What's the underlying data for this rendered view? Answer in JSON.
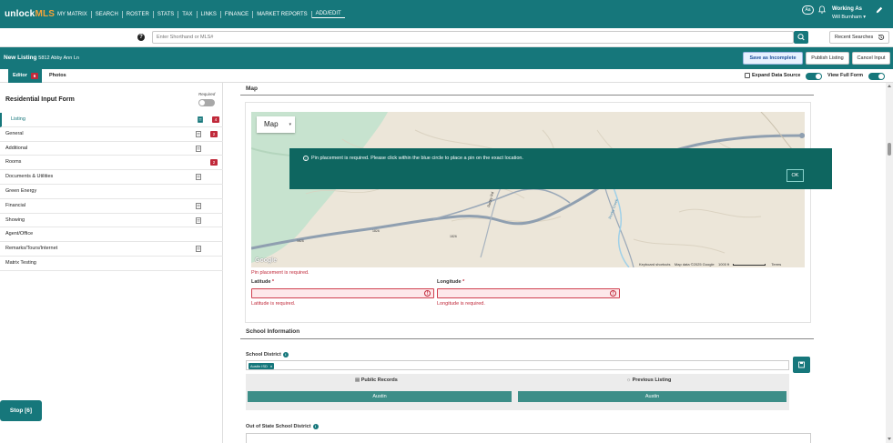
{
  "brand": {
    "unlock": "unlock",
    "mls": "MLS"
  },
  "nav": {
    "links": [
      "MY MATRIX",
      "SEARCH",
      "ROSTER",
      "STATS",
      "TAX",
      "LINKS",
      "FINANCE",
      "MARKET REPORTS",
      "ADD/EDIT"
    ],
    "active": "ADD/EDIT",
    "font_toggle": "Aa",
    "working_as_label": "Working As",
    "user_name": "Will Burnham ▾"
  },
  "search": {
    "placeholder": "Enter Shorthand or MLS#",
    "recent_label": "Recent Searches"
  },
  "listing": {
    "title": "New Listing",
    "address": "5812 Abby Ann Ln",
    "buttons": {
      "save_incomplete": "Save as Incomplete",
      "publish": "Publish Listing",
      "cancel": "Cancel Input"
    }
  },
  "tabs": {
    "editor": "Editor",
    "editor_count": "6",
    "photos": "Photos",
    "expand_data_source": "Expand Data Source",
    "view_full_form": "View Full Form"
  },
  "sidebar": {
    "title": "Residential Input Form",
    "required_label": "Required",
    "items": [
      {
        "label": "Listing",
        "icon": "doc-icon",
        "badge": "4"
      },
      {
        "label": "General",
        "icon": "doc-icon",
        "badge": "2"
      },
      {
        "label": "Additional",
        "icon": "doc-icon",
        "badge": ""
      },
      {
        "label": "Rooms",
        "icon": "",
        "badge": "2"
      },
      {
        "label": "Documents & Utilities",
        "icon": "doc-icon",
        "badge": ""
      },
      {
        "label": "Green Energy",
        "icon": "",
        "badge": ""
      },
      {
        "label": "Financial",
        "icon": "doc-icon",
        "badge": ""
      },
      {
        "label": "Showing",
        "icon": "doc-icon",
        "badge": ""
      },
      {
        "label": "Agent/Office",
        "icon": "",
        "badge": ""
      },
      {
        "label": "Remarks/Tours/Internet",
        "icon": "doc-icon",
        "badge": ""
      },
      {
        "label": "Matrix Testing",
        "icon": "",
        "badge": ""
      }
    ],
    "stop_label": "Stop [6]"
  },
  "map_section": {
    "title": "Map",
    "map_type": "Map",
    "google_logo": "Google",
    "road_labels": [
      "1826",
      "1826",
      "Rocky Rd",
      "1826",
      "Rocky Creek"
    ],
    "footer": {
      "shortcuts": "Keyboard shortcuts",
      "data": "Map data ©2025 Google",
      "scale": "1000 ft",
      "terms": "Terms"
    },
    "alert": {
      "message": "Pin placement is required. Please click within the blue circle to place a pin on the exact location.",
      "ok": "OK"
    },
    "pin_error": "Pin placement is required.",
    "latitude": {
      "label": "Latitude",
      "required_mark": "*",
      "value": "",
      "error": "Latitude is required."
    },
    "longitude": {
      "label": "Longitude",
      "required_mark": "*",
      "value": "",
      "error": "Longitude is required."
    }
  },
  "school": {
    "title": "School Information",
    "district_label": "School District",
    "district_chip": "Austin ISD",
    "public_records": "Public Records",
    "previous_listing": "Previous Listing",
    "public_value": "Austin",
    "previous_value": "Austin",
    "out_of_state_label": "Out of State School District"
  },
  "colors": {
    "brand_teal": "#16777b",
    "error_red": "#c0293a",
    "alert_bg": "#0e6660",
    "mls_orange": "#f2a33a"
  }
}
